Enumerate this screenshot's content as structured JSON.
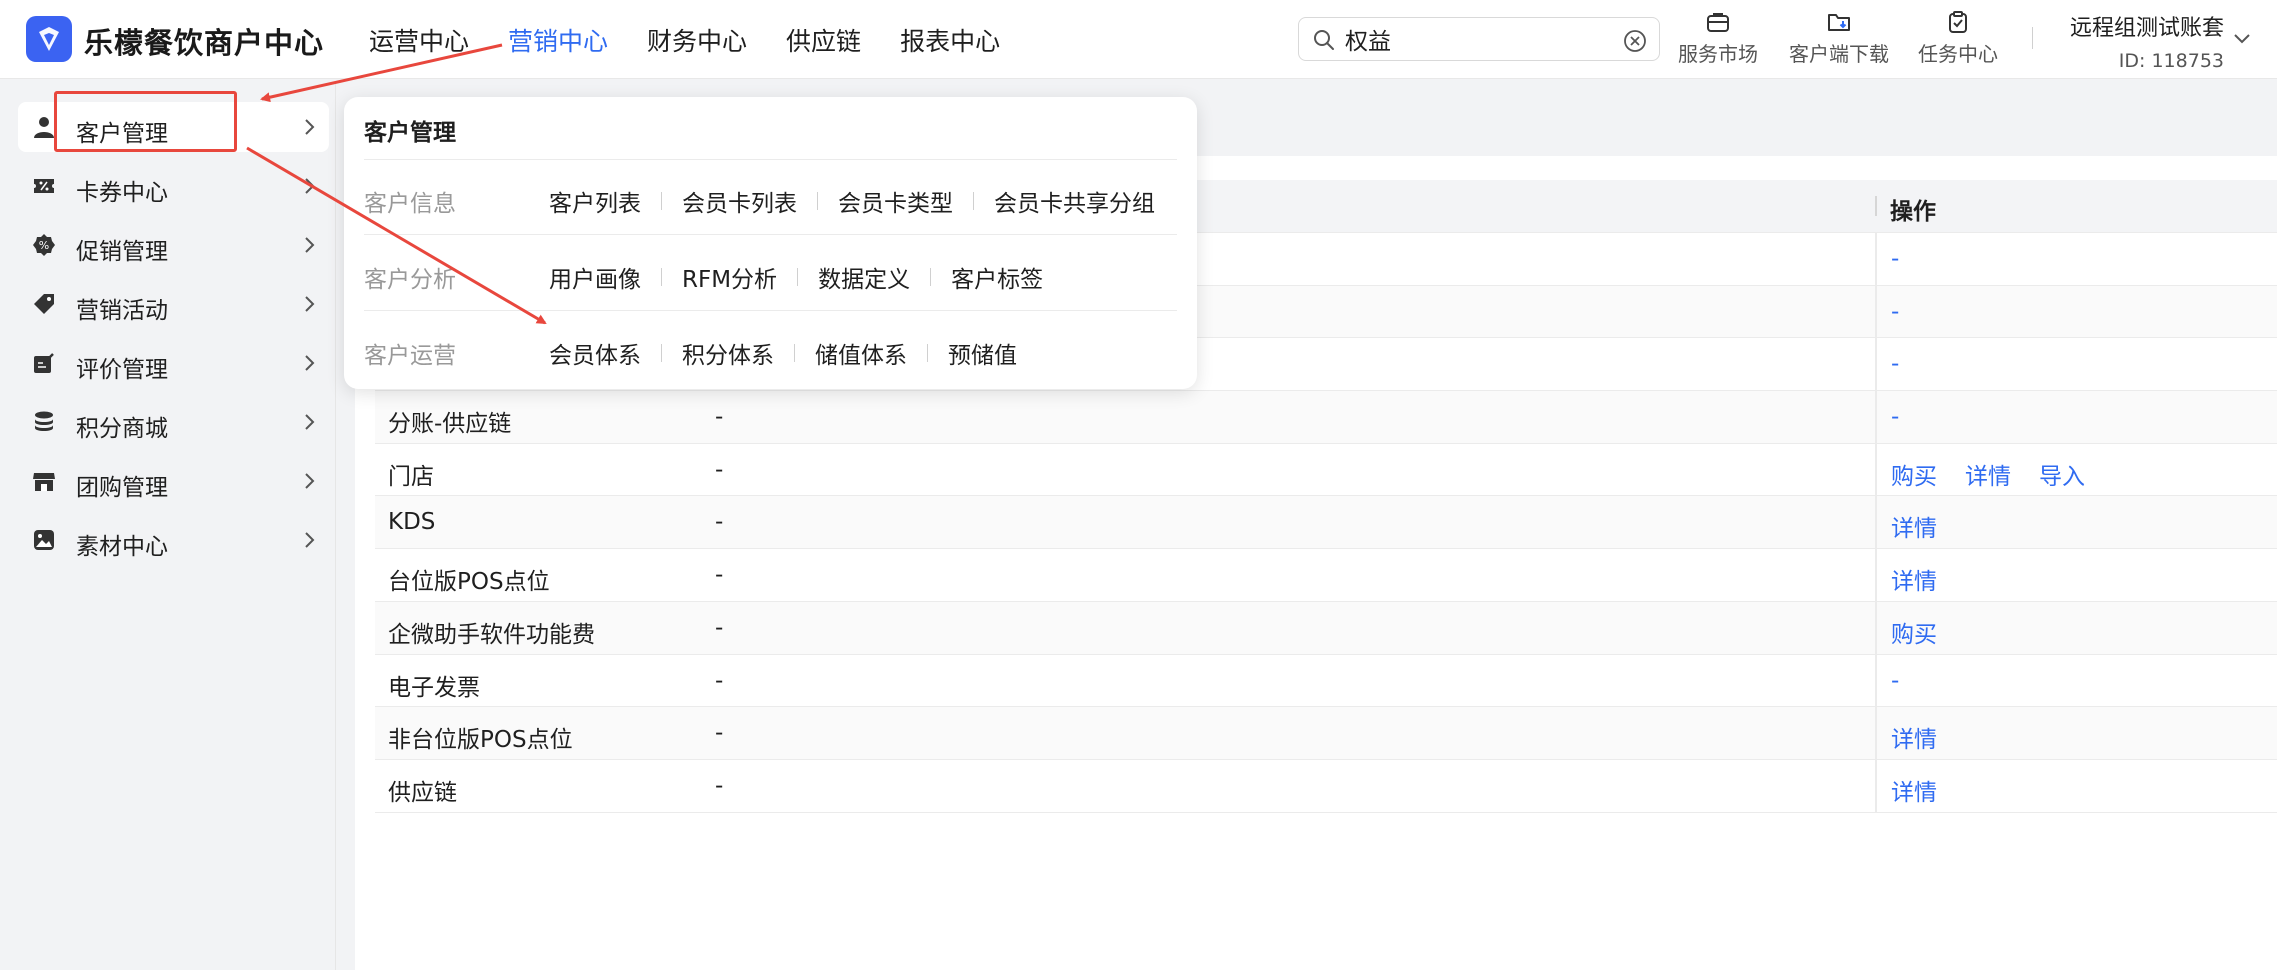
{
  "header": {
    "brand": "乐檬餐饮商户中心",
    "nav": [
      "运营中心",
      "营销中心",
      "财务中心",
      "供应链",
      "报表中心"
    ],
    "active_nav": "营销中心",
    "search": {
      "value": "权益",
      "placeholder": ""
    },
    "tools": [
      {
        "label": "服务市场",
        "icon": "briefcase-icon"
      },
      {
        "label": "客户端下载",
        "icon": "folder-download-icon"
      },
      {
        "label": "任务中心",
        "icon": "clipboard-check-icon"
      }
    ],
    "account": {
      "name": "远程组测试账套",
      "id": "ID: 118753"
    }
  },
  "sidebar": {
    "items": [
      {
        "label": "客户管理",
        "icon": "user-icon"
      },
      {
        "label": "卡券中心",
        "icon": "ticket-icon"
      },
      {
        "label": "促销管理",
        "icon": "promotion-icon"
      },
      {
        "label": "营销活动",
        "icon": "tag-icon"
      },
      {
        "label": "评价管理",
        "icon": "edit-review-icon"
      },
      {
        "label": "积分商城",
        "icon": "coins-icon"
      },
      {
        "label": "团购管理",
        "icon": "store-icon"
      },
      {
        "label": "素材中心",
        "icon": "image-icon"
      }
    ]
  },
  "dropdown": {
    "title": "客户管理",
    "groups": [
      {
        "name": "客户信息",
        "links": [
          "客户列表",
          "会员卡列表",
          "会员卡类型",
          "会员卡共享分组"
        ]
      },
      {
        "name": "客户分析",
        "links": [
          "用户画像",
          "RFM分析",
          "数据定义",
          "客户标签"
        ]
      },
      {
        "name": "客户运营",
        "links": [
          "会员体系",
          "积分体系",
          "储值体系",
          "预储值"
        ]
      }
    ]
  },
  "table": {
    "op_header": "操作",
    "rows": [
      {
        "name": "",
        "value": "",
        "ops": [
          "-"
        ]
      },
      {
        "name": "",
        "value": "",
        "ops": [
          "-"
        ]
      },
      {
        "name": "",
        "value": "",
        "ops": [
          "-"
        ]
      },
      {
        "name": "分账-供应链",
        "value": "-",
        "ops": [
          "-"
        ]
      },
      {
        "name": "门店",
        "value": "-",
        "ops": [
          "购买",
          "详情",
          "导入"
        ]
      },
      {
        "name": "KDS",
        "value": "-",
        "ops": [
          "详情"
        ]
      },
      {
        "name": "台位版POS点位",
        "value": "-",
        "ops": [
          "详情"
        ]
      },
      {
        "name": "企微助手软件功能费",
        "value": "-",
        "ops": [
          "购买"
        ]
      },
      {
        "name": "电子发票",
        "value": "-",
        "ops": [
          "-"
        ]
      },
      {
        "name": "非台位版POS点位",
        "value": "-",
        "ops": [
          "详情"
        ]
      },
      {
        "name": "供应链",
        "value": "-",
        "ops": [
          "详情"
        ]
      }
    ]
  },
  "colors": {
    "accent": "#2f6bf1",
    "brand": "#3b63f2",
    "annotation": "#e8473d"
  }
}
